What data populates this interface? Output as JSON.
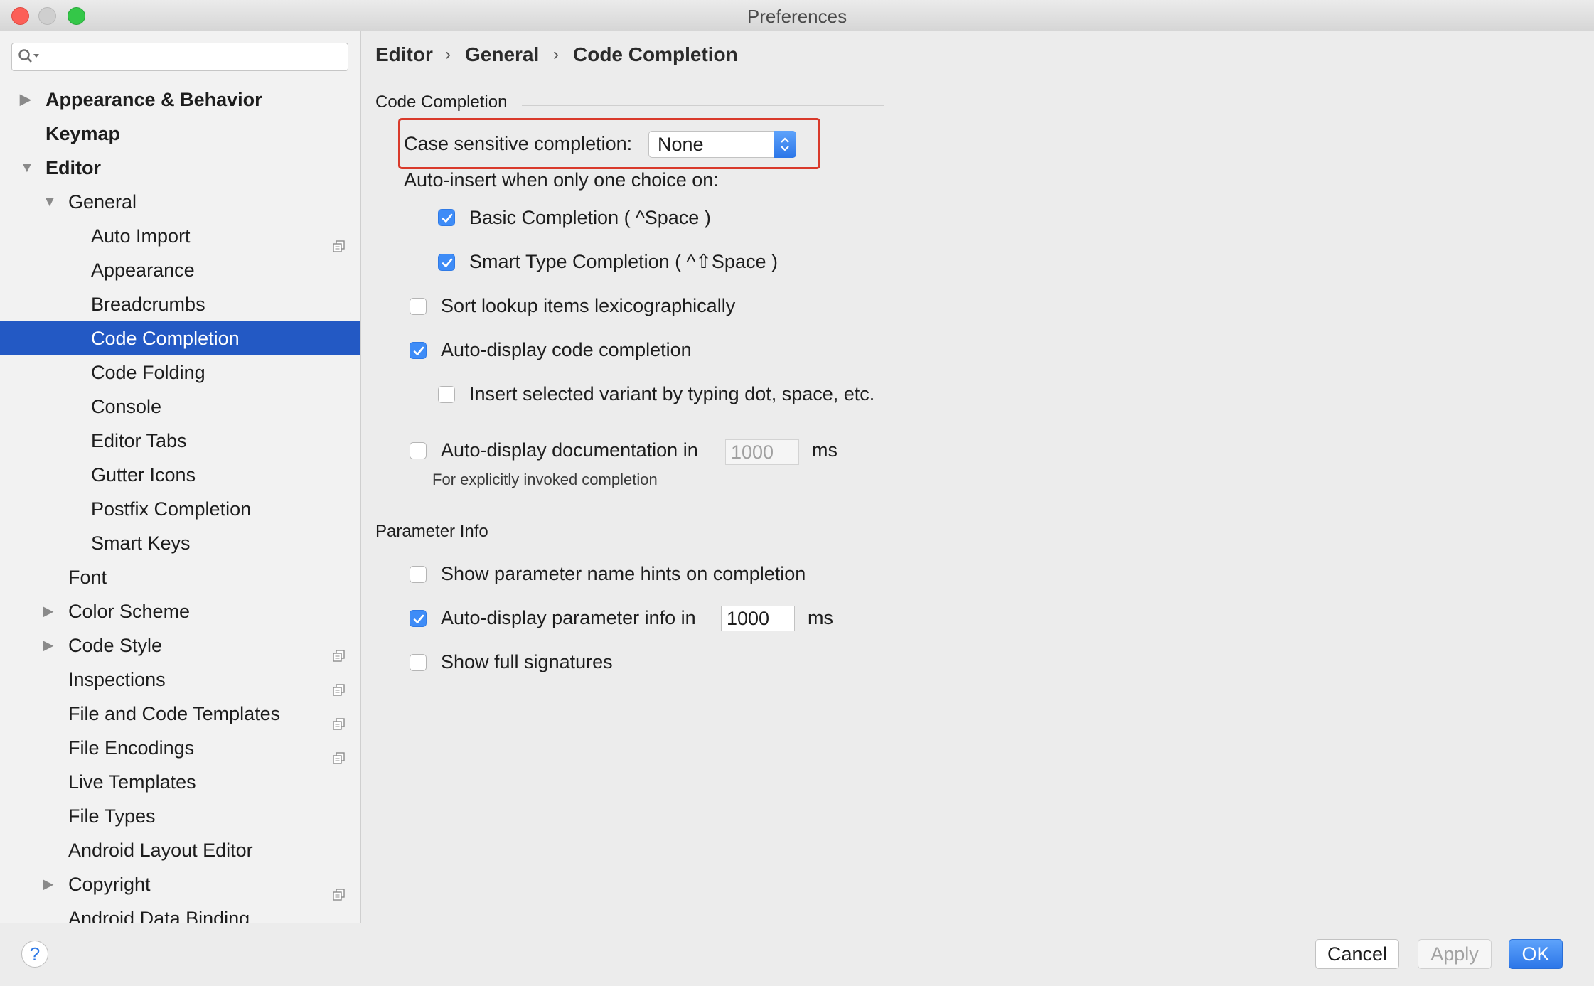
{
  "window": {
    "title": "Preferences"
  },
  "search": {
    "placeholder": ""
  },
  "sidebar": {
    "items": [
      {
        "label": "Appearance & Behavior",
        "level": 0,
        "bold": true,
        "arrow": "right",
        "project": false
      },
      {
        "label": "Keymap",
        "level": 0,
        "bold": true,
        "arrow": "",
        "project": false
      },
      {
        "label": "Editor",
        "level": 0,
        "bold": true,
        "arrow": "down",
        "project": false
      },
      {
        "label": "General",
        "level": 1,
        "bold": false,
        "arrow": "down",
        "project": false
      },
      {
        "label": "Auto Import",
        "level": 2,
        "bold": false,
        "arrow": "",
        "project": true
      },
      {
        "label": "Appearance",
        "level": 2,
        "bold": false,
        "arrow": "",
        "project": false
      },
      {
        "label": "Breadcrumbs",
        "level": 2,
        "bold": false,
        "arrow": "",
        "project": false
      },
      {
        "label": "Code Completion",
        "level": 2,
        "bold": false,
        "arrow": "",
        "project": false,
        "selected": true
      },
      {
        "label": "Code Folding",
        "level": 2,
        "bold": false,
        "arrow": "",
        "project": false
      },
      {
        "label": "Console",
        "level": 2,
        "bold": false,
        "arrow": "",
        "project": false
      },
      {
        "label": "Editor Tabs",
        "level": 2,
        "bold": false,
        "arrow": "",
        "project": false
      },
      {
        "label": "Gutter Icons",
        "level": 2,
        "bold": false,
        "arrow": "",
        "project": false
      },
      {
        "label": "Postfix Completion",
        "level": 2,
        "bold": false,
        "arrow": "",
        "project": false
      },
      {
        "label": "Smart Keys",
        "level": 2,
        "bold": false,
        "arrow": "",
        "project": false
      },
      {
        "label": "Font",
        "level": 1,
        "bold": false,
        "arrow": "",
        "project": false
      },
      {
        "label": "Color Scheme",
        "level": 1,
        "bold": false,
        "arrow": "right",
        "project": false
      },
      {
        "label": "Code Style",
        "level": 1,
        "bold": false,
        "arrow": "right",
        "project": true
      },
      {
        "label": "Inspections",
        "level": 1,
        "bold": false,
        "arrow": "",
        "project": true
      },
      {
        "label": "File and Code Templates",
        "level": 1,
        "bold": false,
        "arrow": "",
        "project": true
      },
      {
        "label": "File Encodings",
        "level": 1,
        "bold": false,
        "arrow": "",
        "project": true
      },
      {
        "label": "Live Templates",
        "level": 1,
        "bold": false,
        "arrow": "",
        "project": false
      },
      {
        "label": "File Types",
        "level": 1,
        "bold": false,
        "arrow": "",
        "project": false
      },
      {
        "label": "Android Layout Editor",
        "level": 1,
        "bold": false,
        "arrow": "",
        "project": false
      },
      {
        "label": "Copyright",
        "level": 1,
        "bold": false,
        "arrow": "right",
        "project": true
      },
      {
        "label": "Android Data Binding",
        "level": 1,
        "bold": false,
        "arrow": "",
        "project": false
      }
    ]
  },
  "breadcrumb": {
    "items": [
      "Editor",
      "General",
      "Code Completion"
    ],
    "separator": "›"
  },
  "code_completion": {
    "section_title": "Code Completion",
    "case_sensitive_label": "Case sensitive completion:",
    "case_sensitive_value": "None",
    "auto_insert_label": "Auto-insert when only one choice on:",
    "basic_completion": {
      "label": "Basic Completion ( ^Space )",
      "checked": true
    },
    "smart_type_completion": {
      "label": "Smart Type Completion ( ^⇧Space )",
      "checked": true
    },
    "sort_lookup": {
      "label": "Sort lookup items lexicographically",
      "checked": false
    },
    "auto_display_completion": {
      "label": "Auto-display code completion",
      "checked": true
    },
    "insert_selected_variant": {
      "label": "Insert selected variant by typing dot, space, etc.",
      "checked": false
    },
    "auto_display_doc": {
      "label": "Auto-display documentation in",
      "checked": false,
      "value": "1000",
      "unit": "ms"
    },
    "doc_hint": "For explicitly invoked completion"
  },
  "parameter_info": {
    "section_title": "Parameter Info",
    "show_name_hints": {
      "label": "Show parameter name hints on completion",
      "checked": false
    },
    "auto_display_param": {
      "label": "Auto-display parameter info in",
      "checked": true,
      "value": "1000",
      "unit": "ms"
    },
    "show_full_signatures": {
      "label": "Show full signatures",
      "checked": false
    }
  },
  "footer": {
    "help_label": "?",
    "cancel_label": "Cancel",
    "apply_label": "Apply",
    "ok_label": "OK"
  },
  "colors": {
    "accent": "#2359c4",
    "checkbox": "#3e8cf7",
    "highlight_border": "#d93a2b"
  }
}
